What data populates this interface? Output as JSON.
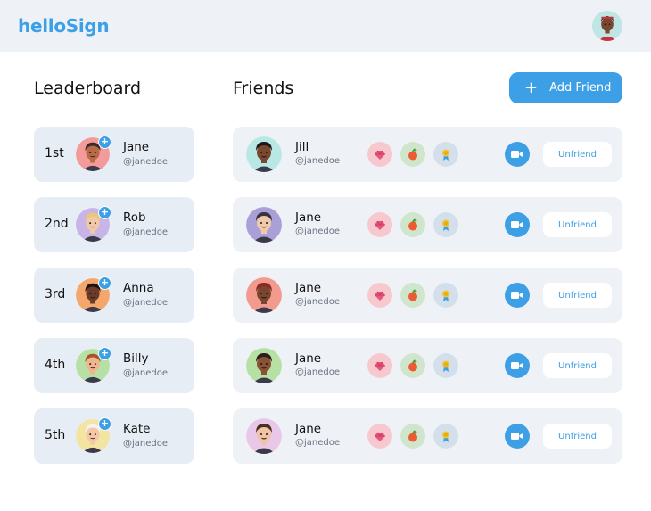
{
  "app": {
    "logo": "helloSign"
  },
  "leaderboard": {
    "title": "Leaderboard",
    "entries": [
      {
        "rank": "1st",
        "name": "Jane",
        "handle": "@janedoe",
        "avatar_bg": "#f39a9a",
        "skin": "#b86a48",
        "hair": "#3a2a26"
      },
      {
        "rank": "2nd",
        "name": "Rob",
        "handle": "@janedoe",
        "avatar_bg": "#c9b4e8",
        "skin": "#f2c9a8",
        "hair": "#e8c870"
      },
      {
        "rank": "3rd",
        "name": "Anna",
        "handle": "@janedoe",
        "avatar_bg": "#f5a66b",
        "skin": "#6b3b28",
        "hair": "#1c1414"
      },
      {
        "rank": "4th",
        "name": "Billy",
        "handle": "@janedoe",
        "avatar_bg": "#b6e0a4",
        "skin": "#f0b48e",
        "hair": "#a8542a"
      },
      {
        "rank": "5th",
        "name": "Kate",
        "handle": "@janedoe",
        "avatar_bg": "#f3e4a2",
        "skin": "#f3c8a6",
        "hair": "#f2f2f2"
      }
    ],
    "add_badge": "+"
  },
  "friends": {
    "title": "Friends",
    "add_button": {
      "icon": "plus-icon",
      "plus": "+",
      "label": "Add Friend"
    },
    "entries": [
      {
        "name": "Jill",
        "handle": "@janedoe",
        "avatar_bg": "#b7e8e4",
        "skin": "#7a4630",
        "hair": "#1e1818"
      },
      {
        "name": "Jane",
        "handle": "@janedoe",
        "avatar_bg": "#a9a0d8",
        "skin": "#f0c9a8",
        "hair": "#3a3040"
      },
      {
        "name": "Jane",
        "handle": "@janedoe",
        "avatar_bg": "#f39a8e",
        "skin": "#7a4630",
        "hair": "#8a2a22"
      },
      {
        "name": "Jane",
        "handle": "@janedoe",
        "avatar_bg": "#b6e0a4",
        "skin": "#8a5234",
        "hair": "#2a1e1a"
      },
      {
        "name": "Jane",
        "handle": "@janedoe",
        "avatar_bg": "#e9c7e8",
        "skin": "#f0c4a4",
        "hair": "#4a2e22"
      }
    ],
    "unfriend_label": "Unfriend",
    "badges": [
      "gem-icon",
      "apple-icon",
      "medal-icon"
    ],
    "video_icon": "video-camera-icon"
  },
  "colors": {
    "accent": "#3d9fe6",
    "header_bg": "#eef2f7",
    "card_bg": "#eef2f7",
    "lb_card_bg": "#e6edf5"
  }
}
